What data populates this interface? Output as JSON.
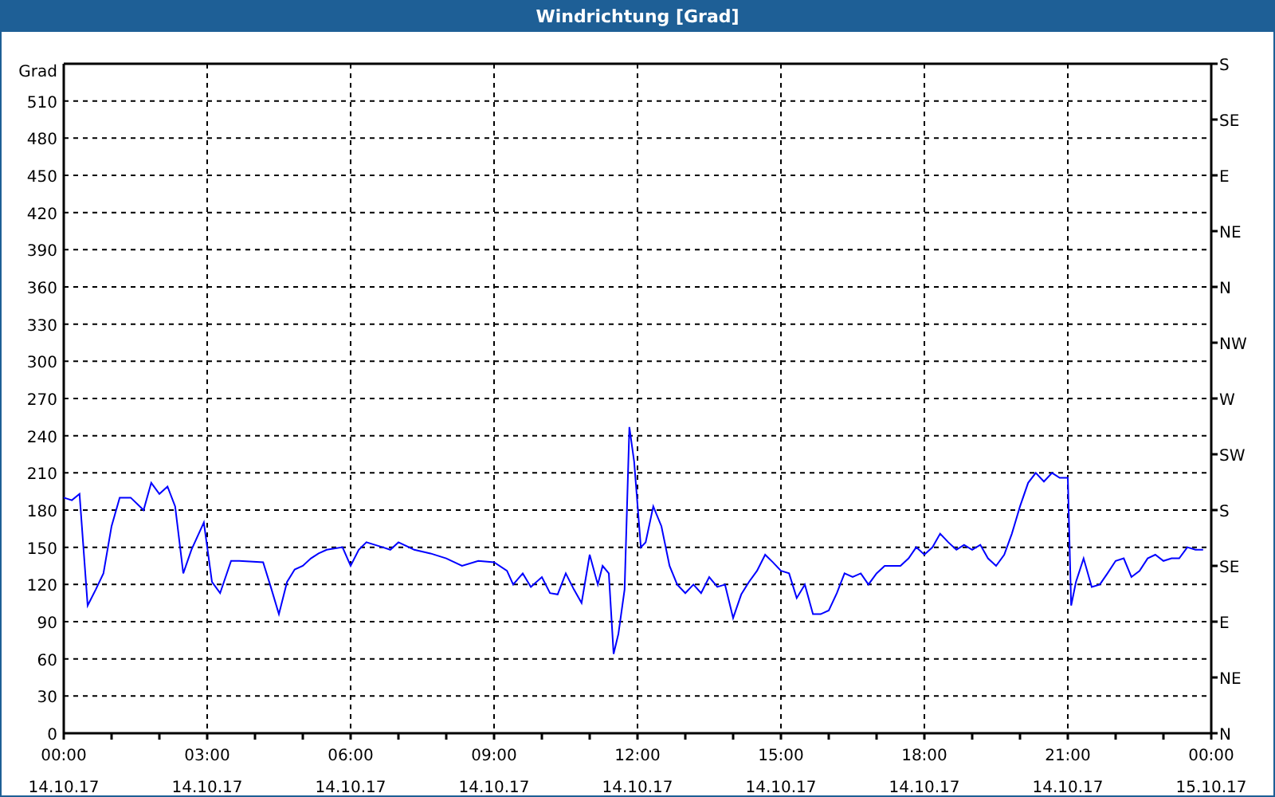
{
  "window": {
    "title": "Windrichtung [Grad]"
  },
  "chart": {
    "chart_data": {
      "type": "line",
      "grid": true,
      "ylabel": "Grad",
      "xlim": [
        0,
        24
      ],
      "ylim": [
        0,
        540
      ],
      "yticks": [
        0,
        30,
        60,
        90,
        120,
        150,
        180,
        210,
        240,
        270,
        300,
        330,
        360,
        390,
        420,
        450,
        480,
        510
      ],
      "xticks": [
        {
          "value": 0,
          "label": "00:00"
        },
        {
          "value": 3,
          "label": "03:00"
        },
        {
          "value": 6,
          "label": "06:00"
        },
        {
          "value": 9,
          "label": "09:00"
        },
        {
          "value": 12,
          "label": "12:00"
        },
        {
          "value": 15,
          "label": "15:00"
        },
        {
          "value": 18,
          "label": "18:00"
        },
        {
          "value": 21,
          "label": "21:00"
        },
        {
          "value": 24,
          "label": "00:00"
        }
      ],
      "x": [
        0,
        0.17,
        0.33,
        0.5,
        0.67,
        0.83,
        1,
        1.17,
        1.4,
        1.67,
        1.83,
        2,
        2.17,
        2.33,
        2.5,
        2.67,
        2.93,
        3.1,
        3.27,
        3.5,
        3.67,
        4.17,
        4.33,
        4.5,
        4.67,
        4.83,
        5,
        5.17,
        5.33,
        5.5,
        5.83,
        6,
        6.17,
        6.33,
        6.67,
        6.83,
        7,
        7.33,
        7.67,
        8,
        8.33,
        8.67,
        9,
        9.27,
        9.4,
        9.6,
        9.77,
        10,
        10.17,
        10.33,
        10.5,
        10.67,
        10.83,
        11,
        11.17,
        11.27,
        11.4,
        11.5,
        11.6,
        11.73,
        11.83,
        11.93,
        12.07,
        12.17,
        12.33,
        12.5,
        12.67,
        12.83,
        13,
        13.17,
        13.33,
        13.5,
        13.67,
        13.83,
        14,
        14.17,
        14.33,
        14.5,
        14.67,
        14.83,
        15,
        15.17,
        15.33,
        15.5,
        15.67,
        15.83,
        16,
        16.17,
        16.33,
        16.5,
        16.67,
        16.83,
        17,
        17.17,
        17.5,
        17.67,
        17.83,
        18,
        18.17,
        18.33,
        18.5,
        18.67,
        18.83,
        19,
        19.17,
        19.33,
        19.5,
        19.67,
        19.83,
        20,
        20.17,
        20.33,
        20.5,
        20.67,
        20.83,
        21,
        21.07,
        21.17,
        21.33,
        21.5,
        21.67,
        21.83,
        22,
        22.17,
        22.33,
        22.5,
        22.67,
        22.83,
        23,
        23.17,
        23.33,
        23.5,
        23.67,
        23.83
      ],
      "series": [
        {
          "color": "#0000ff",
          "values": [
            190,
            188,
            193,
            103,
            116,
            129,
            167,
            190,
            190,
            180,
            202,
            193,
            199,
            183,
            129,
            148,
            170,
            122,
            113,
            139,
            139,
            138,
            118,
            96,
            122,
            132,
            135,
            141,
            145,
            148,
            150,
            135,
            148,
            154,
            150,
            148,
            154,
            148,
            145,
            141,
            135,
            139,
            138,
            131,
            120,
            129,
            118,
            126,
            113,
            112,
            129,
            116,
            105,
            144,
            120,
            135,
            129,
            64,
            80,
            116,
            247,
            219,
            150,
            154,
            183,
            167,
            135,
            120,
            113,
            120,
            113,
            126,
            118,
            120,
            93,
            112,
            122,
            131,
            144,
            138,
            131,
            129,
            109,
            120,
            96,
            96,
            99,
            113,
            129,
            126,
            129,
            120,
            129,
            135,
            135,
            141,
            150,
            144,
            150,
            161,
            154,
            148,
            152,
            148,
            152,
            141,
            135,
            144,
            161,
            183,
            202,
            210,
            203,
            210,
            206,
            206,
            103,
            122,
            141,
            118,
            120,
            129,
            139,
            141,
            126,
            131,
            141,
            144,
            139,
            141,
            141,
            150,
            148,
            148
          ]
        }
      ]
    },
    "x_dates": [
      "14.10.17",
      "14.10.17",
      "14.10.17",
      "14.10.17",
      "14.10.17",
      "14.10.17",
      "14.10.17",
      "14.10.17",
      "15.10.17"
    ],
    "right_axis": {
      "labels": [
        "S",
        "SE",
        "E",
        "NE",
        "N",
        "NW",
        "W",
        "SW",
        "S",
        "SE",
        "E",
        "NE",
        "N"
      ]
    }
  }
}
